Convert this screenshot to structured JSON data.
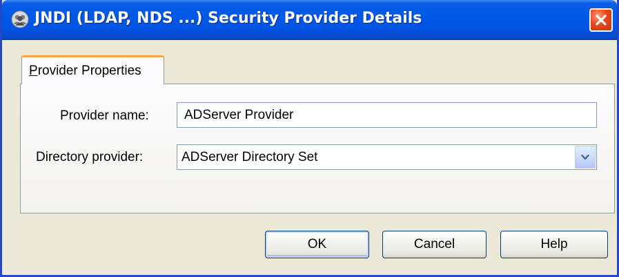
{
  "window": {
    "title": "JNDI (LDAP, NDS ...) Security Provider Details",
    "title_icon": "user-group-icon",
    "close_icon": "close-icon"
  },
  "tabs": [
    {
      "label_underlined": "P",
      "label_rest": "rovider Properties",
      "active": true
    }
  ],
  "form": {
    "provider_name_label": "Provider name:",
    "provider_name_value": "ADServer Provider",
    "directory_provider_label": "Directory provider:",
    "directory_provider_value": "ADServer Directory Set",
    "dropdown_icon": "chevron-down-icon"
  },
  "buttons": {
    "ok": "OK",
    "cancel": "Cancel",
    "help": "Help"
  },
  "colors": {
    "titlebar": "#0054e3",
    "window_bg": "#ece9d8",
    "tab_accent": "#f7a34a",
    "close_button": "#e7461f"
  }
}
